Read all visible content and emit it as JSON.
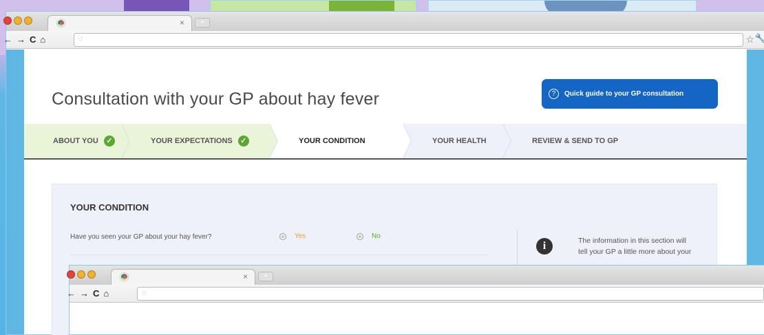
{
  "main_window": {
    "tab": {
      "close": "×"
    },
    "toolbar": {
      "back": "←",
      "forward": "→",
      "reload": "C",
      "home": "⌂",
      "address_value": ""
    }
  },
  "page": {
    "title": "Consultation with your GP about hay fever",
    "guide_button": {
      "icon": "?",
      "label": "Quick guide to your GP consultation"
    },
    "steps": [
      {
        "label": "ABOUT YOU",
        "status": "complete"
      },
      {
        "label": "YOUR EXPECTATIONS",
        "status": "complete"
      },
      {
        "label": "YOUR CONDITION",
        "status": "current"
      },
      {
        "label": "YOUR HEALTH",
        "status": "upcoming"
      },
      {
        "label": "REVIEW & SEND TO GP",
        "status": "upcoming"
      }
    ],
    "section": {
      "title": "YOUR CONDITION",
      "question": "Have you seen your GP about your hay fever?",
      "options": [
        {
          "label": "Yes",
          "color": "#e3a136"
        },
        {
          "label": "No",
          "color": "#5aa733"
        }
      ],
      "info_icon": "i",
      "info_text": "The information in this section will tell your GP a little more about your"
    }
  },
  "second_window": {
    "tab": {
      "close": "×"
    },
    "toolbar": {
      "back": "←",
      "forward": "→",
      "reload": "C",
      "home": "⌂",
      "address_value": ""
    }
  },
  "colors": {
    "accent_blue": "#1565c4",
    "complete_green": "#5aa733",
    "background_blue": "#55b4e6",
    "background_lavender": "#cfc0ec"
  },
  "icons": [
    "chrome-favicon",
    "close-tab-icon",
    "new-tab-icon",
    "back-arrow-icon",
    "forward-arrow-icon",
    "reload-icon",
    "home-icon",
    "globe-icon",
    "star-icon",
    "wrench-icon",
    "question-icon",
    "check-icon",
    "info-icon"
  ]
}
